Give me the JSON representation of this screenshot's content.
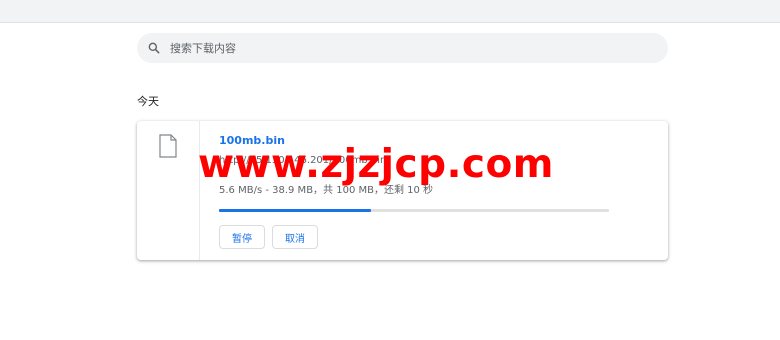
{
  "search": {
    "placeholder": "搜索下载内容"
  },
  "section": {
    "title": "今天"
  },
  "download": {
    "filename": "100mb.bin",
    "url": "http://45.130.146.201/100mb.bin",
    "status": "5.6 MB/s - 38.9 MB，共 100 MB，还剩 10 秒",
    "progress": 0.389,
    "pause_label": "暂停",
    "cancel_label": "取消"
  },
  "watermark": {
    "text": "www.zjzjcp.com"
  },
  "colors": {
    "accent": "#1a73e8",
    "watermark": "#ff0000",
    "track": "#e0e0e0"
  }
}
